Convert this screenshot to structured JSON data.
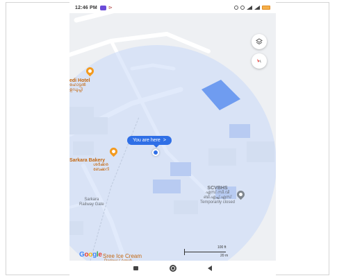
{
  "status_bar": {
    "time": "12:46 PM",
    "extra": "⊳",
    "icons": [
      "location-icon",
      "alarm-icon",
      "signal-icon",
      "signal-icon",
      "battery-icon"
    ]
  },
  "map": {
    "buttons": {
      "layers_icon": "layers-icon",
      "compass_icon": "compass-icon"
    },
    "places": {
      "hotel_name": "edi Hotel",
      "hotel_sub1": "ഹോട്ടൽ",
      "hotel_sub2": "ഉഡുപ്പി",
      "bakery_name": "Sarkara Bakery",
      "bakery_sub1": "ശർക്കര",
      "bakery_sub2": "ബേക്കറി",
      "railway_line1": "Sarkara",
      "railway_line2": "Railway Gate",
      "scvbhs_name": "SCVBHS",
      "scvbhs_sub1": "എസ്.സി.വി",
      "scvbhs_sub2": "ബി.എച്ച്.എസ്",
      "scvbhs_status": "Temporarily closed",
      "bottom_place": "Sree Ice Cream",
      "bottom_place2": "Parlour ( Amul)"
    },
    "you_are_here": "You are here",
    "you_are_here_arrow": ">",
    "google": [
      "G",
      "o",
      "o",
      "g",
      "l",
      "e"
    ],
    "google_colors": [
      "#4285F4",
      "#EA4335",
      "#FBBC05",
      "#4285F4",
      "#34A853",
      "#EA4335"
    ],
    "scale": {
      "top": "100 ft",
      "bottom": "20 m"
    },
    "colors": {
      "accuracy_circle": "#c9d8f7",
      "building_highlight": "#6f9cf0",
      "marker": "#2f6fe6",
      "poi_orange": "#f39a1e"
    }
  },
  "nav_bar": {
    "items": [
      "recents-button",
      "home-button",
      "back-button"
    ]
  }
}
